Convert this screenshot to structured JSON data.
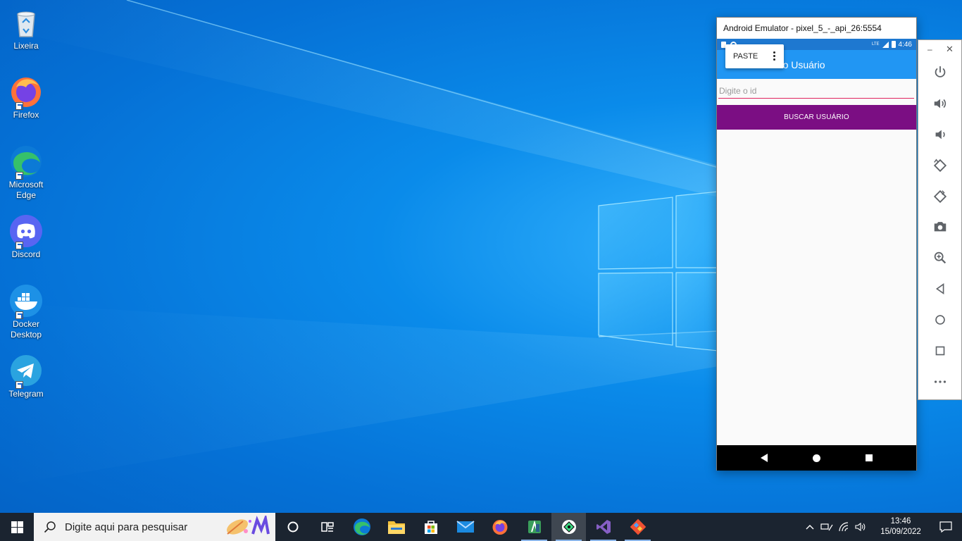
{
  "desktop": {
    "icons": [
      {
        "label": "Lixeira",
        "icon": "recycle-bin-icon"
      },
      {
        "label": "Firefox",
        "icon": "firefox-icon"
      },
      {
        "label": "Microsoft Edge",
        "icon": "edge-icon"
      },
      {
        "label": "Discord",
        "icon": "discord-icon"
      },
      {
        "label": "Docker Desktop",
        "icon": "docker-icon"
      },
      {
        "label": "Telegram",
        "icon": "telegram-icon"
      }
    ]
  },
  "emulator": {
    "title": "Android Emulator - pixel_5_-_api_26:5554",
    "status_bar": {
      "time": "4:46",
      "network_label": "LTE"
    },
    "app_bar": {
      "title": "ndo Usuário"
    },
    "paste_popup": {
      "label": "PASTE"
    },
    "input": {
      "placeholder": "Digite o id",
      "value": ""
    },
    "button": {
      "label": "BUSCAR USUÁRIO"
    },
    "toolbar": {
      "minimize": "–",
      "close": "✕",
      "buttons": [
        "power-icon",
        "volume-up-icon",
        "volume-down-icon",
        "rotate-left-icon",
        "rotate-right-icon",
        "camera-icon",
        "zoom-icon",
        "back-icon",
        "home-icon",
        "overview-icon",
        "more-icon"
      ]
    }
  },
  "taskbar": {
    "search_placeholder": "Digite aqui para pesquisar",
    "apps": [
      "cortana-icon",
      "task-view-icon",
      "edge-icon",
      "file-explorer-icon",
      "store-icon",
      "mail-icon",
      "firefox-icon",
      "android-studio-icon",
      "emulator-icon",
      "visual-studio-icon",
      "git-icon"
    ],
    "tray": {
      "time": "13:46",
      "date": "15/09/2022"
    }
  },
  "colors": {
    "app_bar": "#2196f3",
    "status_bar": "#1e78d0",
    "button": "#7b0e83",
    "input_underline": "#e0245e",
    "taskbar": "#1b2430"
  }
}
